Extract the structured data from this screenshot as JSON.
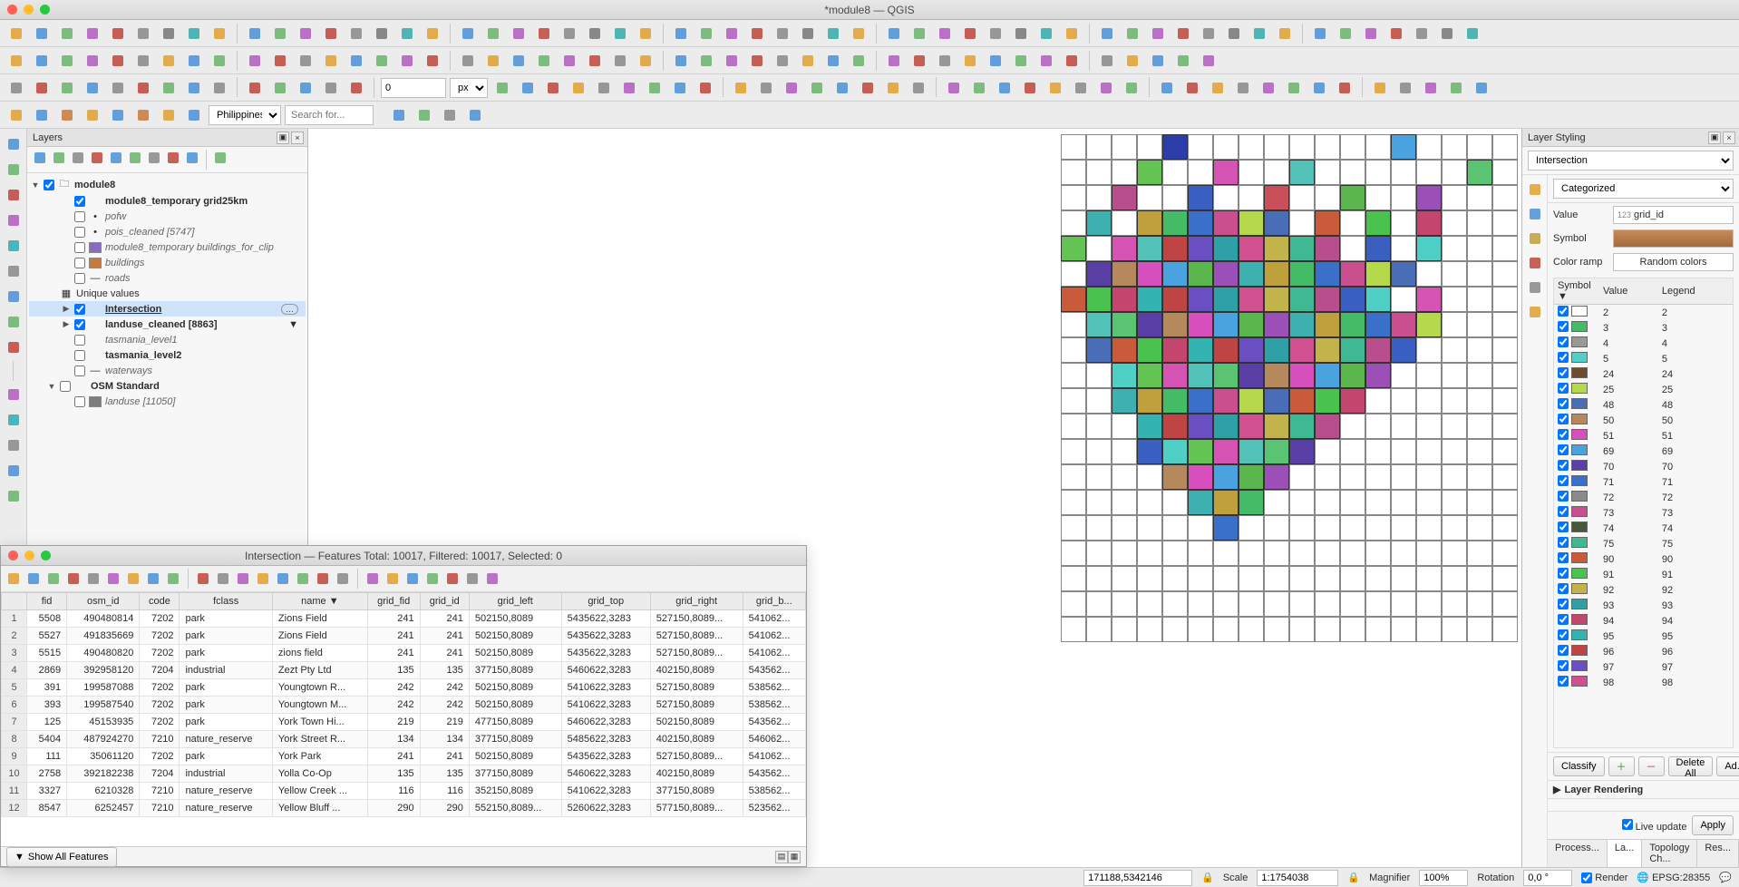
{
  "title": "*module8 — QGIS",
  "toolbar3": {
    "spin_value": "0",
    "unit": "px"
  },
  "toolbar4": {
    "country": "Philippines",
    "search_placeholder": "Search for..."
  },
  "panels": {
    "layers_title": "Layers",
    "layer_styling_title": "Layer Styling",
    "attr_footer_btn": "Show All Features"
  },
  "layers": {
    "root": "module8",
    "items": [
      {
        "depth": 1,
        "chk": true,
        "bold": true,
        "color": null,
        "name": "module8_temporary grid25km"
      },
      {
        "depth": 1,
        "chk": false,
        "italic": true,
        "dot": true,
        "name": "pofw"
      },
      {
        "depth": 1,
        "chk": false,
        "italic": true,
        "dot": true,
        "name": "pois_cleaned [5747]"
      },
      {
        "depth": 1,
        "chk": false,
        "italic": true,
        "color": "#8a6bc2",
        "name": "module8_temporary buildings_for_clip"
      },
      {
        "depth": 1,
        "chk": false,
        "italic": true,
        "color": "#c97a3a",
        "name": "buildings"
      },
      {
        "depth": 1,
        "chk": false,
        "italic": true,
        "line": true,
        "name": "roads"
      },
      {
        "depth": 0,
        "icon": "table",
        "name": "Unique values"
      },
      {
        "depth": 1,
        "chk": true,
        "expander": "▶",
        "selected": true,
        "und": true,
        "name": "Intersection",
        "mem": true
      },
      {
        "depth": 1,
        "chk": true,
        "expander": "▶",
        "bold": true,
        "name": "landuse_cleaned [8863]",
        "filter": true
      },
      {
        "depth": 1,
        "chk": false,
        "italic": true,
        "name": "tasmania_level1"
      },
      {
        "depth": 1,
        "chk": false,
        "bold": true,
        "name": "tasmania_level2"
      },
      {
        "depth": 1,
        "chk": false,
        "italic": true,
        "line": true,
        "name": "waterways"
      },
      {
        "depth": 0,
        "expander": "▼",
        "chk": false,
        "bold": true,
        "name": "OSM Standard"
      },
      {
        "depth": 1,
        "chk": false,
        "italic": true,
        "color": "#7d7d7d",
        "name": "landuse [11050]"
      }
    ]
  },
  "attr": {
    "title": "Intersection — Features Total: 10017, Filtered: 10017, Selected: 0",
    "columns": [
      "fid",
      "osm_id",
      "code",
      "fclass",
      "name",
      "grid_fid",
      "grid_id",
      "grid_left",
      "grid_top",
      "grid_right",
      "grid_b..."
    ],
    "sort_col": "name",
    "rows": [
      [
        "1",
        "5508",
        "490480814",
        "7202",
        "park",
        "Zions Field",
        "241",
        "241",
        "502150,8089",
        "5435622,3283",
        "527150,8089...",
        "541062..."
      ],
      [
        "2",
        "5527",
        "491835669",
        "7202",
        "park",
        "Zions Field",
        "241",
        "241",
        "502150,8089",
        "5435622,3283",
        "527150,8089...",
        "541062..."
      ],
      [
        "3",
        "5515",
        "490480820",
        "7202",
        "park",
        "zions field",
        "241",
        "241",
        "502150,8089",
        "5435622,3283",
        "527150,8089...",
        "541062..."
      ],
      [
        "4",
        "2869",
        "392958120",
        "7204",
        "industrial",
        "Zezt Pty Ltd",
        "135",
        "135",
        "377150,8089",
        "5460622,3283",
        "402150,8089",
        "543562..."
      ],
      [
        "5",
        "391",
        "199587088",
        "7202",
        "park",
        "Youngtown R...",
        "242",
        "242",
        "502150,8089",
        "5410622,3283",
        "527150,8089",
        "538562..."
      ],
      [
        "6",
        "393",
        "199587540",
        "7202",
        "park",
        "Youngtown M...",
        "242",
        "242",
        "502150,8089",
        "5410622,3283",
        "527150,8089",
        "538562..."
      ],
      [
        "7",
        "125",
        "45153935",
        "7202",
        "park",
        "York Town Hi...",
        "219",
        "219",
        "477150,8089",
        "5460622,3283",
        "502150,8089",
        "543562..."
      ],
      [
        "8",
        "5404",
        "487924270",
        "7210",
        "nature_reserve",
        "York Street R...",
        "134",
        "134",
        "377150,8089",
        "5485622,3283",
        "402150,8089",
        "546062..."
      ],
      [
        "9",
        "111",
        "35061120",
        "7202",
        "park",
        "York Park",
        "241",
        "241",
        "502150,8089",
        "5435622,3283",
        "527150,8089...",
        "541062..."
      ],
      [
        "10",
        "2758",
        "392182238",
        "7204",
        "industrial",
        "Yolla Co-Op",
        "135",
        "135",
        "377150,8089",
        "5460622,3283",
        "402150,8089",
        "543562..."
      ],
      [
        "11",
        "3327",
        "6210328",
        "7210",
        "nature_reserve",
        "Yellow Creek ...",
        "116",
        "116",
        "352150,8089",
        "5410622,3283",
        "377150,8089",
        "538562..."
      ],
      [
        "12",
        "8547",
        "6252457",
        "7210",
        "nature_reserve",
        "Yellow Bluff ...",
        "290",
        "290",
        "552150,8089...",
        "5260622,3283",
        "577150,8089...",
        "523562..."
      ]
    ]
  },
  "layer_styling": {
    "layer": "Intersection",
    "renderer": "Categorized",
    "value_label": "Value",
    "value_field": "grid_id",
    "value_field_prefix": "123",
    "symbol_label": "Symbol",
    "ramp_label": "Color ramp",
    "ramp_value": "Random colors",
    "cat_headers": [
      "Symbol",
      "Value",
      "Legend"
    ],
    "classify": "Classify",
    "delete_all": "Delete All",
    "advanced": "Ad...",
    "rendering_section": "Layer Rendering",
    "live_update": "Live update",
    "apply": "Apply",
    "tabs": [
      "Process...",
      "La...",
      "Topology Ch...",
      "Res..."
    ],
    "categories": [
      {
        "v": "2",
        "c": "#ffffff"
      },
      {
        "v": "3",
        "c": "#44bb66"
      },
      {
        "v": "4",
        "c": "#999999"
      },
      {
        "v": "5",
        "c": "#4fd0c7"
      },
      {
        "v": "24",
        "c": "#6b4e2f"
      },
      {
        "v": "25",
        "c": "#b6d94b"
      },
      {
        "v": "48",
        "c": "#4a6db8"
      },
      {
        "v": "50",
        "c": "#b6895c"
      },
      {
        "v": "51",
        "c": "#d64fbd"
      },
      {
        "v": "69",
        "c": "#4aa3de"
      },
      {
        "v": "70",
        "c": "#5a3fa6"
      },
      {
        "v": "71",
        "c": "#3a70c9"
      },
      {
        "v": "72",
        "c": "#8a8a8a"
      },
      {
        "v": "73",
        "c": "#c94f8f"
      },
      {
        "v": "74",
        "c": "#455a3b"
      },
      {
        "v": "75",
        "c": "#3fb894"
      },
      {
        "v": "90",
        "c": "#c95b3a"
      },
      {
        "v": "91",
        "c": "#49c24e"
      },
      {
        "v": "92",
        "c": "#c2b44a"
      },
      {
        "v": "93",
        "c": "#2fa1a6"
      },
      {
        "v": "94",
        "c": "#c4466e"
      },
      {
        "v": "95",
        "c": "#34b3b3"
      },
      {
        "v": "96",
        "c": "#bf4545"
      },
      {
        "v": "97",
        "c": "#6a4fc2"
      },
      {
        "v": "98",
        "c": "#d15090"
      }
    ]
  },
  "statusbar": {
    "coord": "171188,5342146",
    "scale_label": "Scale",
    "scale": "1:1754038",
    "mag_label": "Magnifier",
    "mag": "100%",
    "rot_label": "Rotation",
    "rot": "0,0 °",
    "render": "Render",
    "epsg": "EPSG:28355"
  },
  "map_grid": {
    "cols": 18,
    "rows": 20,
    "cell": 28,
    "ox": 12,
    "oy": 6,
    "cells": [
      {
        "r": 0,
        "c": 4,
        "on": "#2b3ea9"
      },
      {
        "r": 0,
        "c": 13,
        "on": "#4aa3de"
      },
      {
        "r": 1,
        "c": 3,
        "on": "#64c453"
      },
      {
        "r": 1,
        "c": 6,
        "on": "#d453b3"
      },
      {
        "r": 1,
        "c": 9,
        "on": "#52c2b8"
      },
      {
        "r": 1,
        "c": 16,
        "on": "#5ac472"
      },
      {
        "r": 2,
        "c": 2,
        "on": "#b84f8c"
      },
      {
        "r": 2,
        "c": 5,
        "on": "#3960c0"
      },
      {
        "r": 2,
        "c": 8,
        "on": "#c94f5a"
      },
      {
        "r": 2,
        "c": 11,
        "on": "#5bb64e"
      },
      {
        "r": 2,
        "c": 14,
        "on": "#9c4fb6"
      },
      {
        "r": 3,
        "c": 1,
        "on": "#3eb0b0"
      },
      {
        "r": 3,
        "c": 3,
        "on": "#c0a03c"
      },
      {
        "r": 3,
        "c": 4,
        "on": "#44bb66"
      },
      {
        "r": 3,
        "c": 5,
        "on": "#3a70c9"
      },
      {
        "r": 3,
        "c": 6,
        "on": "#c94f8f"
      },
      {
        "r": 3,
        "c": 7,
        "on": "#b6d94b"
      },
      {
        "r": 3,
        "c": 8,
        "on": "#4a6db8"
      },
      {
        "r": 3,
        "c": 10,
        "on": "#c95b3a"
      },
      {
        "r": 3,
        "c": 12,
        "on": "#49c24e"
      },
      {
        "r": 3,
        "c": 14,
        "on": "#c4466e"
      },
      {
        "r": 4,
        "c": 0,
        "on": "#64c453"
      },
      {
        "r": 4,
        "c": 2,
        "on": "#d453b3"
      },
      {
        "r": 4,
        "c": 3,
        "on": "#52c2b8"
      },
      {
        "r": 4,
        "c": 4,
        "on": "#bf4545"
      },
      {
        "r": 4,
        "c": 5,
        "on": "#6a4fc2"
      },
      {
        "r": 4,
        "c": 6,
        "on": "#2fa1a6"
      },
      {
        "r": 4,
        "c": 7,
        "on": "#d15090"
      },
      {
        "r": 4,
        "c": 8,
        "on": "#c2b44a"
      },
      {
        "r": 4,
        "c": 9,
        "on": "#3fb894"
      },
      {
        "r": 4,
        "c": 10,
        "on": "#b84f8c"
      },
      {
        "r": 4,
        "c": 12,
        "on": "#3960c0"
      },
      {
        "r": 4,
        "c": 14,
        "on": "#4fd0c7"
      },
      {
        "r": 5,
        "c": 1,
        "on": "#5a3fa6"
      },
      {
        "r": 5,
        "c": 2,
        "on": "#b6895c"
      },
      {
        "r": 5,
        "c": 3,
        "on": "#d64fbd"
      },
      {
        "r": 5,
        "c": 4,
        "on": "#4aa3de"
      },
      {
        "r": 5,
        "c": 5,
        "on": "#5bb64e"
      },
      {
        "r": 5,
        "c": 6,
        "on": "#9c4fb6"
      },
      {
        "r": 5,
        "c": 7,
        "on": "#3eb0b0"
      },
      {
        "r": 5,
        "c": 8,
        "on": "#c0a03c"
      },
      {
        "r": 5,
        "c": 9,
        "on": "#44bb66"
      },
      {
        "r": 5,
        "c": 10,
        "on": "#3a70c9"
      },
      {
        "r": 5,
        "c": 11,
        "on": "#c94f8f"
      },
      {
        "r": 5,
        "c": 12,
        "on": "#b6d94b"
      },
      {
        "r": 5,
        "c": 13,
        "on": "#4a6db8"
      },
      {
        "r": 6,
        "c": 0,
        "on": "#c95b3a"
      },
      {
        "r": 6,
        "c": 1,
        "on": "#49c24e"
      },
      {
        "r": 6,
        "c": 2,
        "on": "#c4466e"
      },
      {
        "r": 6,
        "c": 3,
        "on": "#34b3b3"
      },
      {
        "r": 6,
        "c": 4,
        "on": "#bf4545"
      },
      {
        "r": 6,
        "c": 5,
        "on": "#6a4fc2"
      },
      {
        "r": 6,
        "c": 6,
        "on": "#2fa1a6"
      },
      {
        "r": 6,
        "c": 7,
        "on": "#d15090"
      },
      {
        "r": 6,
        "c": 8,
        "on": "#c2b44a"
      },
      {
        "r": 6,
        "c": 9,
        "on": "#3fb894"
      },
      {
        "r": 6,
        "c": 10,
        "on": "#b84f8c"
      },
      {
        "r": 6,
        "c": 11,
        "on": "#3960c0"
      },
      {
        "r": 6,
        "c": 12,
        "on": "#4fd0c7"
      },
      {
        "r": 6,
        "c": 14,
        "on": "#d453b3"
      },
      {
        "r": 7,
        "c": 1,
        "on": "#52c2b8"
      },
      {
        "r": 7,
        "c": 2,
        "on": "#5ac472"
      },
      {
        "r": 7,
        "c": 3,
        "on": "#5a3fa6"
      },
      {
        "r": 7,
        "c": 4,
        "on": "#b6895c"
      },
      {
        "r": 7,
        "c": 5,
        "on": "#d64fbd"
      },
      {
        "r": 7,
        "c": 6,
        "on": "#4aa3de"
      },
      {
        "r": 7,
        "c": 7,
        "on": "#5bb64e"
      },
      {
        "r": 7,
        "c": 8,
        "on": "#9c4fb6"
      },
      {
        "r": 7,
        "c": 9,
        "on": "#3eb0b0"
      },
      {
        "r": 7,
        "c": 10,
        "on": "#c0a03c"
      },
      {
        "r": 7,
        "c": 11,
        "on": "#44bb66"
      },
      {
        "r": 7,
        "c": 12,
        "on": "#3a70c9"
      },
      {
        "r": 7,
        "c": 13,
        "on": "#c94f8f"
      },
      {
        "r": 7,
        "c": 14,
        "on": "#b6d94b"
      },
      {
        "r": 8,
        "c": 1,
        "on": "#4a6db8"
      },
      {
        "r": 8,
        "c": 2,
        "on": "#c95b3a"
      },
      {
        "r": 8,
        "c": 3,
        "on": "#49c24e"
      },
      {
        "r": 8,
        "c": 4,
        "on": "#c4466e"
      },
      {
        "r": 8,
        "c": 5,
        "on": "#34b3b3"
      },
      {
        "r": 8,
        "c": 6,
        "on": "#bf4545"
      },
      {
        "r": 8,
        "c": 7,
        "on": "#6a4fc2"
      },
      {
        "r": 8,
        "c": 8,
        "on": "#2fa1a6"
      },
      {
        "r": 8,
        "c": 9,
        "on": "#d15090"
      },
      {
        "r": 8,
        "c": 10,
        "on": "#c2b44a"
      },
      {
        "r": 8,
        "c": 11,
        "on": "#3fb894"
      },
      {
        "r": 8,
        "c": 12,
        "on": "#b84f8c"
      },
      {
        "r": 8,
        "c": 13,
        "on": "#3960c0"
      },
      {
        "r": 9,
        "c": 2,
        "on": "#4fd0c7"
      },
      {
        "r": 9,
        "c": 3,
        "on": "#64c453"
      },
      {
        "r": 9,
        "c": 4,
        "on": "#d453b3"
      },
      {
        "r": 9,
        "c": 5,
        "on": "#52c2b8"
      },
      {
        "r": 9,
        "c": 6,
        "on": "#5ac472"
      },
      {
        "r": 9,
        "c": 7,
        "on": "#5a3fa6"
      },
      {
        "r": 9,
        "c": 8,
        "on": "#b6895c"
      },
      {
        "r": 9,
        "c": 9,
        "on": "#d64fbd"
      },
      {
        "r": 9,
        "c": 10,
        "on": "#4aa3de"
      },
      {
        "r": 9,
        "c": 11,
        "on": "#5bb64e"
      },
      {
        "r": 9,
        "c": 12,
        "on": "#9c4fb6"
      },
      {
        "r": 10,
        "c": 2,
        "on": "#3eb0b0"
      },
      {
        "r": 10,
        "c": 3,
        "on": "#c0a03c"
      },
      {
        "r": 10,
        "c": 4,
        "on": "#44bb66"
      },
      {
        "r": 10,
        "c": 5,
        "on": "#3a70c9"
      },
      {
        "r": 10,
        "c": 6,
        "on": "#c94f8f"
      },
      {
        "r": 10,
        "c": 7,
        "on": "#b6d94b"
      },
      {
        "r": 10,
        "c": 8,
        "on": "#4a6db8"
      },
      {
        "r": 10,
        "c": 9,
        "on": "#c95b3a"
      },
      {
        "r": 10,
        "c": 10,
        "on": "#49c24e"
      },
      {
        "r": 10,
        "c": 11,
        "on": "#c4466e"
      },
      {
        "r": 11,
        "c": 3,
        "on": "#34b3b3"
      },
      {
        "r": 11,
        "c": 4,
        "on": "#bf4545"
      },
      {
        "r": 11,
        "c": 5,
        "on": "#6a4fc2"
      },
      {
        "r": 11,
        "c": 6,
        "on": "#2fa1a6"
      },
      {
        "r": 11,
        "c": 7,
        "on": "#d15090"
      },
      {
        "r": 11,
        "c": 8,
        "on": "#c2b44a"
      },
      {
        "r": 11,
        "c": 9,
        "on": "#3fb894"
      },
      {
        "r": 11,
        "c": 10,
        "on": "#b84f8c"
      },
      {
        "r": 12,
        "c": 3,
        "on": "#3960c0"
      },
      {
        "r": 12,
        "c": 4,
        "on": "#4fd0c7"
      },
      {
        "r": 12,
        "c": 5,
        "on": "#64c453"
      },
      {
        "r": 12,
        "c": 6,
        "on": "#d453b3"
      },
      {
        "r": 12,
        "c": 7,
        "on": "#52c2b8"
      },
      {
        "r": 12,
        "c": 8,
        "on": "#5ac472"
      },
      {
        "r": 12,
        "c": 9,
        "on": "#5a3fa6"
      },
      {
        "r": 13,
        "c": 4,
        "on": "#b6895c"
      },
      {
        "r": 13,
        "c": 5,
        "on": "#d64fbd"
      },
      {
        "r": 13,
        "c": 6,
        "on": "#4aa3de"
      },
      {
        "r": 13,
        "c": 7,
        "on": "#5bb64e"
      },
      {
        "r": 13,
        "c": 8,
        "on": "#9c4fb6"
      },
      {
        "r": 14,
        "c": 5,
        "on": "#3eb0b0"
      },
      {
        "r": 14,
        "c": 6,
        "on": "#c0a03c"
      },
      {
        "r": 14,
        "c": 7,
        "on": "#44bb66"
      },
      {
        "r": 15,
        "c": 6,
        "on": "#3a70c9"
      }
    ]
  }
}
